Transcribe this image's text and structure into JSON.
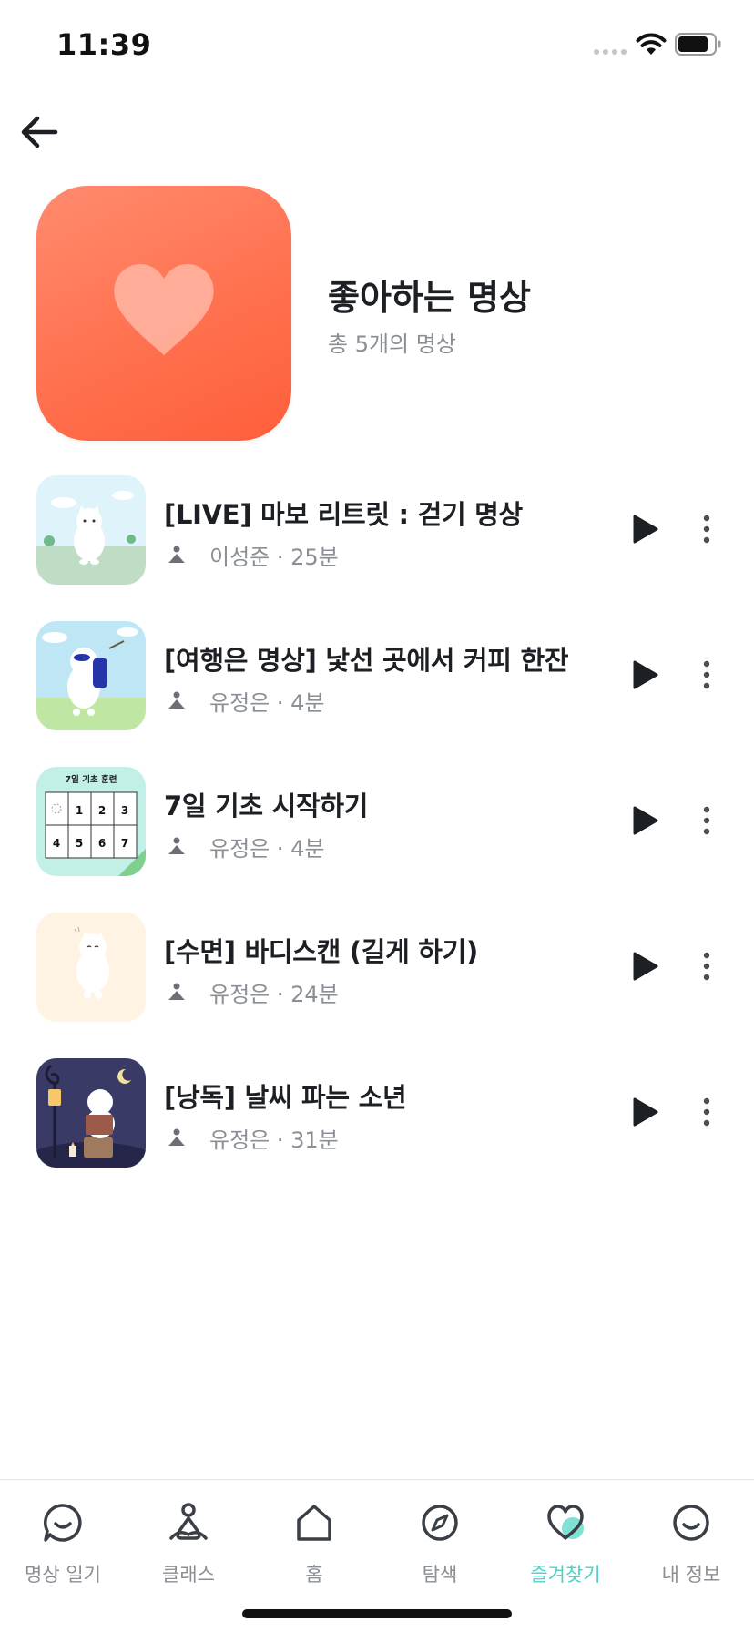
{
  "status_bar": {
    "time": "11:39"
  },
  "header": {
    "title": "좋아하는 명상",
    "subtitle": "총 5개의 명상",
    "cover_icon": "heart-icon",
    "cover_color": "#ff714f"
  },
  "items": [
    {
      "title": "[LIVE] 마보 리트릿 : 걷기 명상",
      "meta": "이성준 · 25분",
      "thumb": "bear-walking-outdoor"
    },
    {
      "title": "[여행은 명상] 낯선 곳에서 커피 한잔",
      "meta": "유정은 · 4분",
      "thumb": "bear-traveler-backpack"
    },
    {
      "title": "7일 기초 시작하기",
      "meta": "유정은 · 4분",
      "thumb": "seven-day-calendar",
      "thumb_text": {
        "heading": "7일 기초 훈련",
        "days": [
          "1",
          "2",
          "3",
          "4",
          "5",
          "6",
          "7"
        ]
      }
    },
    {
      "title": "[수면] 바디스캔 (길게 하기)",
      "meta": "유정은 · 24분",
      "thumb": "bear-cream-background"
    },
    {
      "title": "[낭독] 날씨 파는 소년",
      "meta": "유정은 · 31분",
      "thumb": "bear-reading-night"
    }
  ],
  "tabs": [
    {
      "label": "명상 일기",
      "icon": "smile-chat-icon",
      "active": false
    },
    {
      "label": "클래스",
      "icon": "person-meditation-icon",
      "active": false
    },
    {
      "label": "홈",
      "icon": "home-icon",
      "active": false
    },
    {
      "label": "탐색",
      "icon": "compass-icon",
      "active": false
    },
    {
      "label": "즐겨찾기",
      "icon": "heart-icon",
      "active": true
    },
    {
      "label": "내 정보",
      "icon": "smile-face-icon",
      "active": false
    }
  ],
  "colors": {
    "accent": "#4fd1c5",
    "text_primary": "#1c1f23",
    "text_secondary": "#8a8f96"
  }
}
